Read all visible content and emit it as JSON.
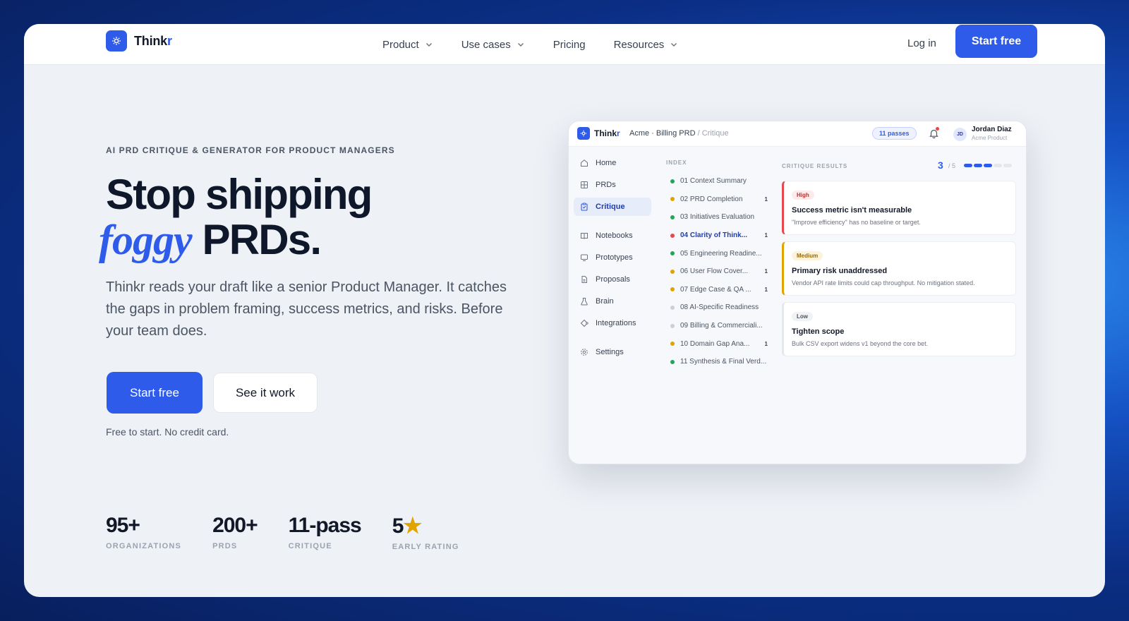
{
  "brand": {
    "name_main": "Think",
    "name_accent": "r"
  },
  "nav": {
    "items": [
      {
        "label": "Product",
        "has_dropdown": true
      },
      {
        "label": "Use cases",
        "has_dropdown": true
      },
      {
        "label": "Pricing",
        "has_dropdown": false
      },
      {
        "label": "Resources",
        "has_dropdown": true
      }
    ],
    "login": "Log in",
    "cta": "Start free"
  },
  "hero": {
    "eyebrow": "AI PRD CRITIQUE & GENERATOR FOR PRODUCT MANAGERS",
    "line1": "Stop shipping",
    "foggy": "foggy",
    "line2_rest": "PRDs.",
    "lede": "Thinkr reads your draft like a senior Product Manager. It catches the gaps in problem framing, success metrics, and risks. Before your team does.",
    "primary_cta": "Start free",
    "secondary_cta": "See it work",
    "fineprint": "Free to start. No credit card."
  },
  "stats": [
    {
      "value": "95+",
      "label": "ORGANIZATIONS"
    },
    {
      "value": "200+",
      "label": "PRDS"
    },
    {
      "value": "11-pass",
      "label": "CRITIQUE"
    },
    {
      "value": "5",
      "star": "★",
      "label": "EARLY RATING"
    }
  ],
  "app": {
    "brand_main": "Think",
    "brand_accent": "r",
    "breadcrumb": "Acme · Billing PRD",
    "breadcrumb_sub": "/ Critique",
    "passes": "11 passes",
    "user": {
      "initials": "JD",
      "name": "Jordan Diaz",
      "org": "Acme Product"
    },
    "sidebar": [
      {
        "label": "Home",
        "icon": "home-icon"
      },
      {
        "label": "PRDs",
        "icon": "grid-icon"
      },
      {
        "label": "Critique",
        "icon": "clipboard-icon",
        "active": true
      },
      {
        "label": "Notebooks",
        "icon": "book-icon"
      },
      {
        "label": "Prototypes",
        "icon": "monitor-icon"
      },
      {
        "label": "Proposals",
        "icon": "file-icon"
      },
      {
        "label": "Brain",
        "icon": "flask-icon"
      },
      {
        "label": "Integrations",
        "icon": "puzzle-icon"
      },
      {
        "label": "Settings",
        "icon": "gear-icon"
      }
    ],
    "index_title": "INDEX",
    "index": [
      {
        "label": "01 Context Summary",
        "color": "#22a559",
        "count": ""
      },
      {
        "label": "02 PRD Completion",
        "color": "#e0a400",
        "count": "1"
      },
      {
        "label": "03 Initiatives Evaluation",
        "color": "#22a559",
        "count": ""
      },
      {
        "label": "04 Clarity of Think...",
        "color": "#e5484d",
        "count": "1",
        "active": true
      },
      {
        "label": "05 Engineering Readine...",
        "color": "#22a559",
        "count": ""
      },
      {
        "label": "06 User Flow Cover...",
        "color": "#e0a400",
        "count": "1"
      },
      {
        "label": "07 Edge Case & QA ...",
        "color": "#e0a400",
        "count": "1"
      },
      {
        "label": "08 AI-Specific Readiness",
        "color": "#cbd0d8",
        "count": ""
      },
      {
        "label": "09 Billing & Commerciali...",
        "color": "#cbd0d8",
        "count": ""
      },
      {
        "label": "10 Domain Gap Ana...",
        "color": "#e0a400",
        "count": "1"
      },
      {
        "label": "11 Synthesis & Final Verd...",
        "color": "#22a559",
        "count": ""
      }
    ],
    "critique_title": "CRITIQUE RESULTS",
    "critique_current": "3",
    "critique_total": "/ 5",
    "critique_progress": 0.6,
    "cards": [
      {
        "severity": "High",
        "sev_color": "#c02d2d",
        "sev_bg": "#fdeaea",
        "accent": "#e5484d",
        "title": "Success metric isn't measurable",
        "body": "\"Improve efficiency\" has no baseline or target."
      },
      {
        "severity": "Medium",
        "sev_color": "#9a6a00",
        "sev_bg": "#fdf3dc",
        "accent": "#e0a400",
        "title": "Primary risk unaddressed",
        "body": "Vendor API rate limits could cap throughput. No mitigation stated."
      },
      {
        "severity": "Low",
        "sev_color": "#4b5563",
        "sev_bg": "#f1f2f4",
        "accent": "#e5e7eb",
        "title": "Tighten scope",
        "body": "Bulk CSV export widens v1 beyond the core bet."
      }
    ]
  },
  "colors": {
    "accent": "#2f5bea",
    "text": "#111827"
  }
}
